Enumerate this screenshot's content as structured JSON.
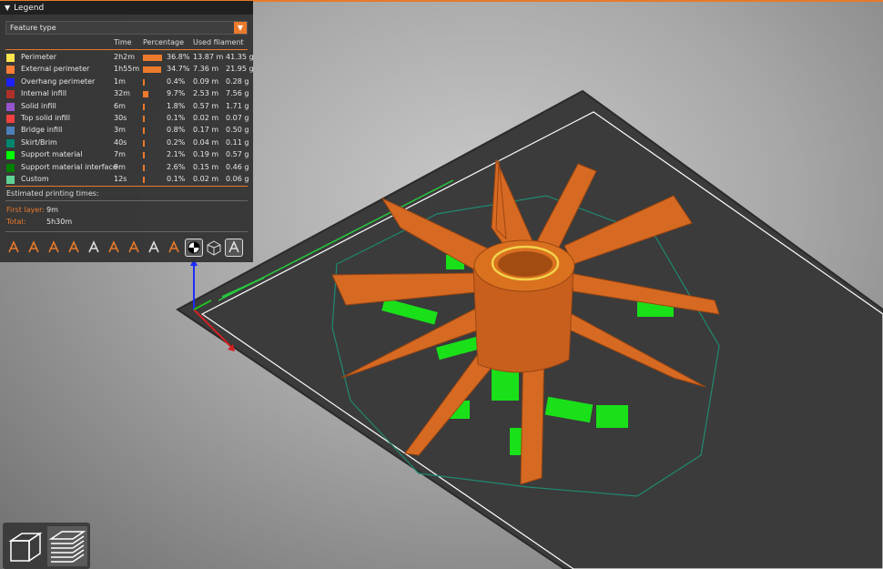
{
  "legend": {
    "title": "Legend",
    "view_type": "Feature type",
    "columns": {
      "time": "Time",
      "percentage": "Percentage",
      "filament": "Used filament"
    },
    "rows": [
      {
        "name": "Perimeter",
        "color": "#ffe64d",
        "time": "2h2m",
        "pct": "36.8%",
        "pct_value": 36.8,
        "meters": "13.87 m",
        "grams": "41.35 g"
      },
      {
        "name": "External perimeter",
        "color": "#ff7d38",
        "time": "1h55m",
        "pct": "34.7%",
        "pct_value": 34.7,
        "meters": "7.36 m",
        "grams": "21.95 g"
      },
      {
        "name": "Overhang perimeter",
        "color": "#1f1fff",
        "time": "1m",
        "pct": "0.4%",
        "pct_value": 0.4,
        "meters": "0.09 m",
        "grams": "0.28 g"
      },
      {
        "name": "Internal infill",
        "color": "#b03029",
        "time": "32m",
        "pct": "9.7%",
        "pct_value": 9.7,
        "meters": "2.53 m",
        "grams": "7.56 g"
      },
      {
        "name": "Solid infill",
        "color": "#9654cc",
        "time": "6m",
        "pct": "1.8%",
        "pct_value": 1.8,
        "meters": "0.57 m",
        "grams": "1.71 g"
      },
      {
        "name": "Top solid infill",
        "color": "#f04040",
        "time": "30s",
        "pct": "0.1%",
        "pct_value": 0.1,
        "meters": "0.02 m",
        "grams": "0.07 g"
      },
      {
        "name": "Bridge infill",
        "color": "#4d80ba",
        "time": "3m",
        "pct": "0.8%",
        "pct_value": 0.8,
        "meters": "0.17 m",
        "grams": "0.50 g"
      },
      {
        "name": "Skirt/Brim",
        "color": "#00876e",
        "time": "40s",
        "pct": "0.2%",
        "pct_value": 0.2,
        "meters": "0.04 m",
        "grams": "0.11 g"
      },
      {
        "name": "Support material",
        "color": "#00ff00",
        "time": "7m",
        "pct": "2.1%",
        "pct_value": 2.1,
        "meters": "0.19 m",
        "grams": "0.57 g"
      },
      {
        "name": "Support material interface",
        "color": "#008000",
        "time": "9m",
        "pct": "2.6%",
        "pct_value": 2.6,
        "meters": "0.15 m",
        "grams": "0.46 g"
      },
      {
        "name": "Custom",
        "color": "#5ed194",
        "time": "12s",
        "pct": "0.1%",
        "pct_value": 0.1,
        "meters": "0.02 m",
        "grams": "0.06 g"
      }
    ],
    "estimated_label": "Estimated printing times:",
    "first_layer_label": "First layer:",
    "first_layer_value": "9m",
    "total_label": "Total:",
    "total_value": "5h30m",
    "toolbar_icons": [
      "travel-icon",
      "wipe-icon",
      "retractions-icon",
      "deretractions-icon",
      "seams-icon",
      "tool-changes-icon",
      "color-changes-icon",
      "pause-icon",
      "custom-gcode-icon",
      "center-of-gravity-icon",
      "shells-icon",
      "tool-marker-icon"
    ]
  },
  "view_buttons": [
    "3d-view-icon",
    "preview-layers-icon"
  ],
  "colors": {
    "accent": "#e8792b",
    "model": "#d2691e",
    "bed": "#3a3a3a"
  }
}
